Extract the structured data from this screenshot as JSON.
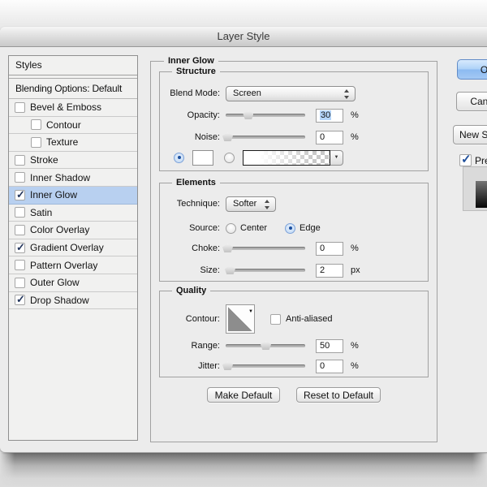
{
  "window": {
    "title": "Layer Style"
  },
  "sidebar": {
    "header": "Styles",
    "blending": "Blending Options: Default",
    "items": [
      {
        "label": "Bevel & Emboss",
        "checked": false,
        "indent": false,
        "selected": false
      },
      {
        "label": "Contour",
        "checked": false,
        "indent": true,
        "selected": false
      },
      {
        "label": "Texture",
        "checked": false,
        "indent": true,
        "selected": false
      },
      {
        "label": "Stroke",
        "checked": false,
        "indent": false,
        "selected": false
      },
      {
        "label": "Inner Shadow",
        "checked": false,
        "indent": false,
        "selected": false
      },
      {
        "label": "Inner Glow",
        "checked": true,
        "indent": false,
        "selected": true
      },
      {
        "label": "Satin",
        "checked": false,
        "indent": false,
        "selected": false
      },
      {
        "label": "Color Overlay",
        "checked": false,
        "indent": false,
        "selected": false
      },
      {
        "label": "Gradient Overlay",
        "checked": true,
        "indent": false,
        "selected": false
      },
      {
        "label": "Pattern Overlay",
        "checked": false,
        "indent": false,
        "selected": false
      },
      {
        "label": "Outer Glow",
        "checked": false,
        "indent": false,
        "selected": false
      },
      {
        "label": "Drop Shadow",
        "checked": true,
        "indent": false,
        "selected": false
      }
    ]
  },
  "panel": {
    "title": "Inner Glow",
    "structure": {
      "title": "Structure",
      "blend_mode_label": "Blend Mode:",
      "blend_mode_value": "Screen",
      "opacity_label": "Opacity:",
      "noise_label": "Noise:"
    },
    "elements": {
      "title": "Elements",
      "technique_label": "Technique:",
      "technique_value": "Softer",
      "source_label": "Source:",
      "source_center": "Center",
      "source_edge": "Edge",
      "choke_label": "Choke:",
      "size_label": "Size:"
    },
    "quality": {
      "title": "Quality",
      "contour_label": "Contour:",
      "antialiased_label": "Anti-aliased",
      "range_label": "Range:",
      "jitter_label": "Jitter:"
    },
    "footer": {
      "make_default": "Make Default",
      "reset_default": "Reset to Default"
    }
  },
  "values": {
    "opacity": "30",
    "noise": "0",
    "choke": "0",
    "size": "2",
    "range": "50",
    "jitter": "0"
  },
  "units": {
    "percent": "%",
    "px": "px"
  },
  "slider_pct": {
    "opacity": 28,
    "noise": 2,
    "choke": 2,
    "size": 5,
    "range": 50,
    "jitter": 2
  },
  "right": {
    "ok": "OK",
    "cancel": "Cancel",
    "new_style": "New Style...",
    "preview": "Preview"
  },
  "icons": {
    "check": "✓",
    "down_arrow": "▼"
  },
  "colors": {
    "selection_blue": "#b8d0f0",
    "value_highlight": "#b5d5fa",
    "ok_button_blue": "#8cbaf1"
  }
}
